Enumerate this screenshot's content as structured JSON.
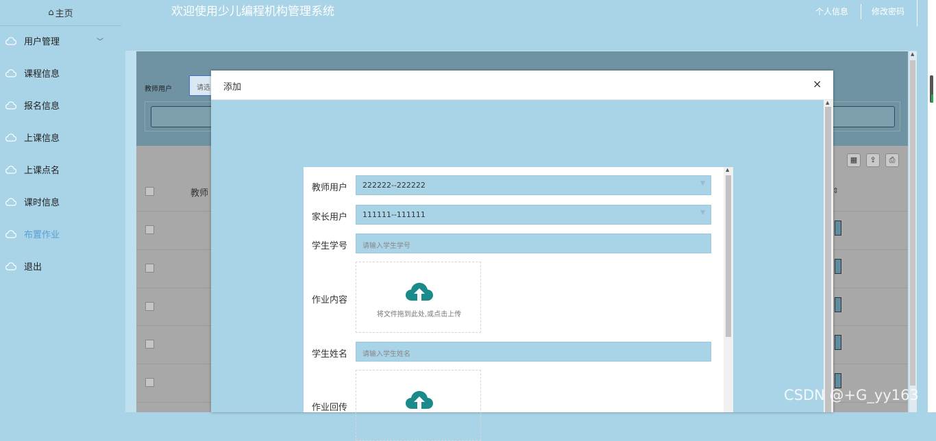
{
  "sidebar": {
    "home": "主页",
    "items": [
      {
        "label": "用户管理",
        "expandable": true
      },
      {
        "label": "课程信息"
      },
      {
        "label": "报名信息"
      },
      {
        "label": "上课信息"
      },
      {
        "label": "上课点名"
      },
      {
        "label": "课时信息"
      },
      {
        "label": "布置作业",
        "active": true
      },
      {
        "label": "退出"
      }
    ]
  },
  "header": {
    "title": "欢迎使用少儿编程机构管理系统",
    "profile_link": "个人信息",
    "password_link": "修改密码"
  },
  "background": {
    "filter_label": "教师用户",
    "filter_placeholder": "请选",
    "column_header": "教师",
    "sort_icon": "⇕"
  },
  "modal": {
    "title": "添加",
    "close_icon": "×",
    "fields": {
      "teacher_label": "教师用户",
      "teacher_value": "222222--222222",
      "parent_label": "家长用户",
      "parent_value": "111111--111111",
      "student_no_label": "学生学号",
      "student_no_placeholder": "请输入学生学号",
      "homework_label": "作业内容",
      "upload_text": "将文件拖到此处,或点击上传",
      "student_name_label": "学生姓名",
      "student_name_placeholder": "请输入学生姓名",
      "reply_label": "作业回传"
    }
  },
  "watermark": "CSDN @+G_yy163",
  "colors": {
    "background": "#a9d3e6",
    "upload_icon": "#1a8a8a",
    "active_menu": "#5a9fd4"
  }
}
